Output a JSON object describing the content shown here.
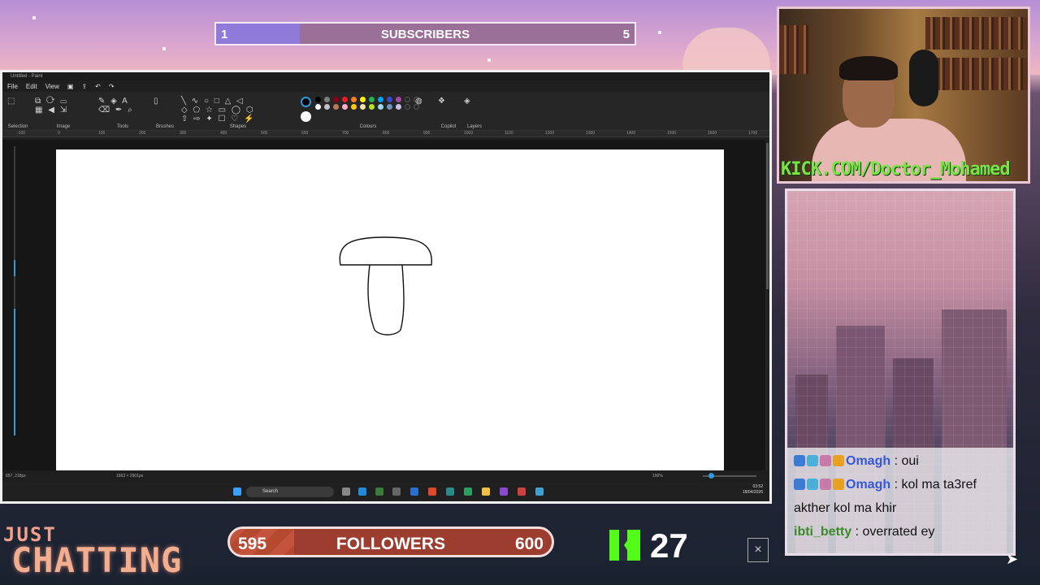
{
  "subscribers": {
    "start": "1",
    "label": "SUBSCRIBERS",
    "end": "5",
    "progress": 0.2
  },
  "paint": {
    "title": "Untitled - Paint",
    "menu": [
      "File",
      "Edit",
      "View"
    ],
    "groups": [
      "Selection",
      "Image",
      "Tools",
      "Brushes",
      "Shapes",
      "Colours",
      "Copilot",
      "Layers"
    ],
    "ruler_ticks": [
      "-100",
      "0",
      "100",
      "200",
      "300",
      "400",
      "500",
      "600",
      "700",
      "800",
      "900",
      "1000",
      "1100",
      "1200",
      "1300",
      "1400",
      "1500",
      "1600",
      "1700"
    ],
    "colors_row1": [
      "#000000",
      "#7f7f7f",
      "#880015",
      "#ed1c24",
      "#ff7f27",
      "#fff200",
      "#22b14c",
      "#00a2e8",
      "#3f48cc",
      "#a349a4"
    ],
    "colors_row2": [
      "#ffffff",
      "#c3c3c3",
      "#b97a57",
      "#ffaec9",
      "#ffc90e",
      "#efe4b0",
      "#b5e61d",
      "#99d9ea",
      "#7092be",
      "#c8bfe7"
    ],
    "status": {
      "position": "857, 218px",
      "canvas_size": "1663 × 2901px",
      "zoom": "100%"
    },
    "taskbar": {
      "search": "Search",
      "time": "03:52",
      "date": "18/04/2026"
    }
  },
  "webcam": {
    "url_text": "KICK.COM/Doctor_Mohamed"
  },
  "chat": {
    "messages": [
      {
        "user": "Omagh",
        "text": " : oui",
        "badges": true
      },
      {
        "user": "Omagh",
        "text": " : kol ma ta3ref akther kol ma khir",
        "badges": true
      },
      {
        "user": "ibti_betty",
        "text": " : overrated ey",
        "badges": false
      }
    ]
  },
  "overlay": {
    "just": "JUST",
    "chatting": "CHATTING",
    "followers": {
      "start": "595",
      "label": "FOLLOWERS",
      "end": "600",
      "progress": 0.2
    },
    "kick_count": "27",
    "close_glyph": "×"
  }
}
